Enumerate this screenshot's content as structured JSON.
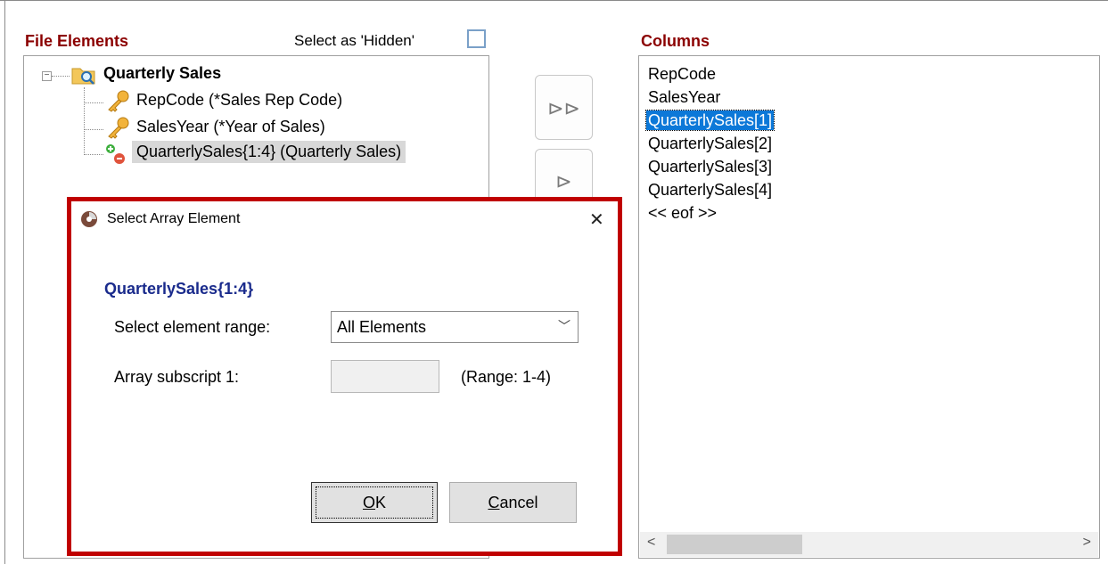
{
  "file_elements": {
    "title": "File Elements",
    "hidden_label": "Select as 'Hidden'",
    "root": "Quarterly Sales",
    "items": [
      "RepCode (*Sales Rep Code)",
      "SalesYear (*Year of Sales)",
      "QuarterlySales{1:4} (Quarterly Sales)"
    ]
  },
  "move_buttons": {
    "move_all_icon": "⊳⊳",
    "move_one_icon": "⊳"
  },
  "columns": {
    "title": "Columns",
    "items": [
      "RepCode",
      "SalesYear",
      "QuarterlySales[1]",
      "QuarterlySales[2]",
      "QuarterlySales[3]",
      "QuarterlySales[4]",
      "<< eof >>"
    ],
    "selected_index": 2
  },
  "dialog": {
    "title": "Select Array Element",
    "heading": "QuarterlySales{1:4}",
    "range_label": "Select element range:",
    "range_value": "All Elements",
    "subscript_label": "Array subscript 1:",
    "subscript_value": "",
    "range_hint": "(Range: 1-4)",
    "ok_rest": "K",
    "ok_underlined": "O",
    "cancel_underlined": "C",
    "cancel_rest": "ancel"
  },
  "colors": {
    "section_title": "#8b0000",
    "dialog_heading": "#1a2b8c",
    "selection": "#0c78d8",
    "dialog_border": "#c00000"
  }
}
